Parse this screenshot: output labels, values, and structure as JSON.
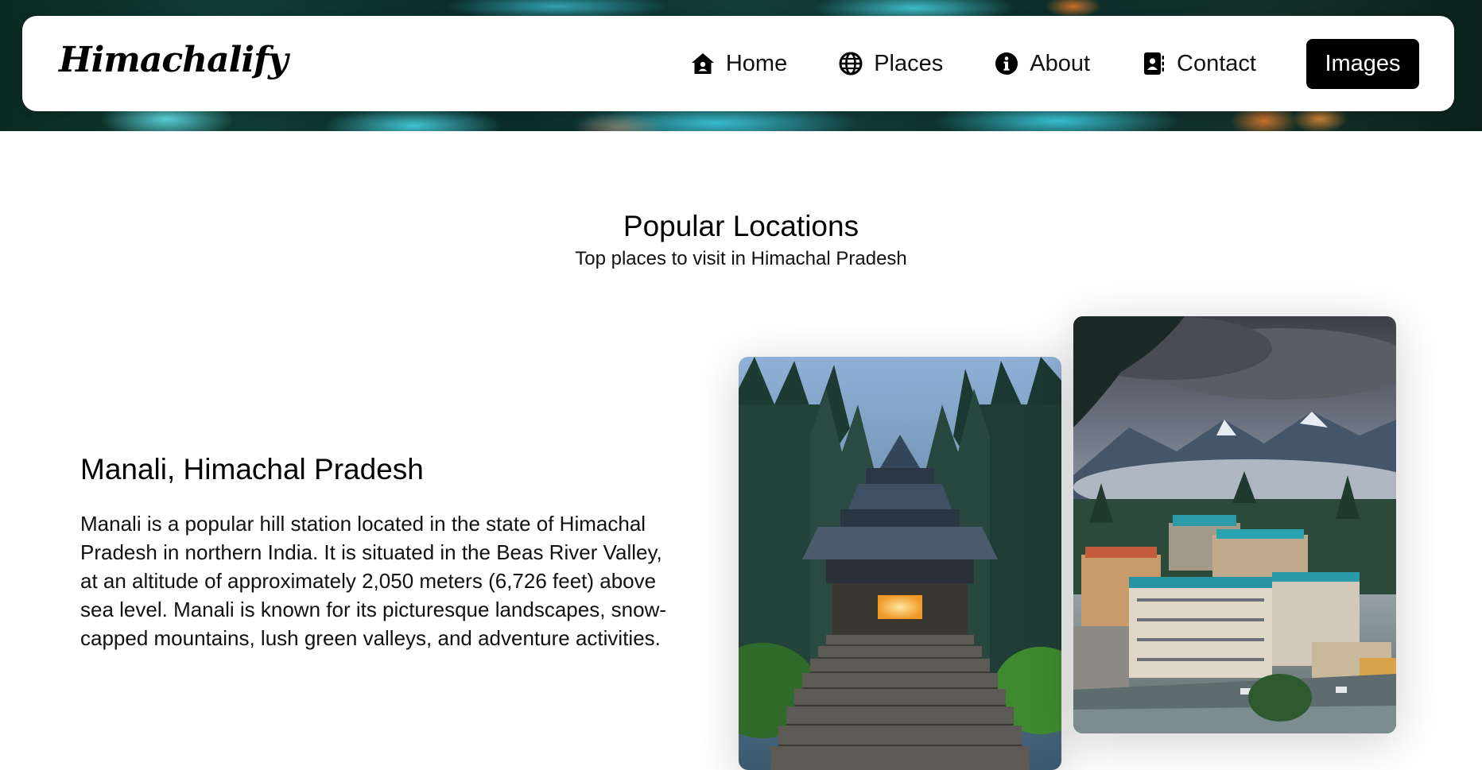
{
  "brand": {
    "name": "Himachalify"
  },
  "nav": {
    "items": [
      {
        "label": "Home",
        "icon": "home-icon"
      },
      {
        "label": "Places",
        "icon": "globe-icon"
      },
      {
        "label": "About",
        "icon": "info-icon"
      },
      {
        "label": "Contact",
        "icon": "contact-book-icon"
      }
    ],
    "button_label": "Images"
  },
  "section": {
    "title": "Popular Locations",
    "subtitle": "Top places to visit in Himachal Pradesh"
  },
  "location": {
    "title": "Manali, Himachal Pradesh",
    "description": "Manali is a popular hill station located in the state of Himachal Pradesh in northern India. It is situated in the Beas River Valley, at an altitude of approximately 2,050 meters (6,726 feet) above sea level. Manali is known for its picturesque landscapes, snow-capped mountains, lush green valleys, and adventure activities."
  },
  "colors": {
    "nav_button_bg": "#000000",
    "nav_button_text": "#ffffff",
    "page_bg": "#ffffff"
  }
}
